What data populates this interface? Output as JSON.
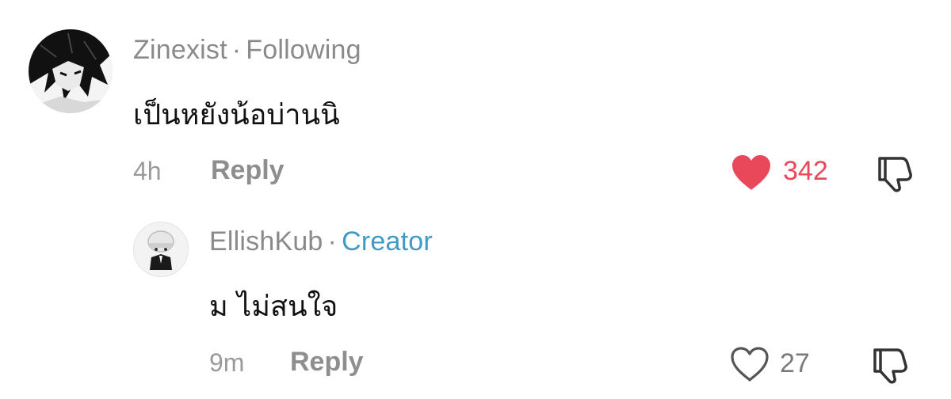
{
  "comments": [
    {
      "username": "Zinexist",
      "separator": "·",
      "badge": "Following",
      "text": "เป็นหยังน้อบ่านนิ",
      "time": "4h",
      "reply_label": "Reply",
      "likes": "342",
      "liked": true,
      "like_color": "#e8485a",
      "avatar_icon": "avatar-manga-character"
    },
    {
      "username": "EllishKub",
      "separator": "·",
      "badge": "Creator",
      "badge_color": "#3e9ac7",
      "text": "ม ไม่สนใจ",
      "time": "9m",
      "reply_label": "Reply",
      "likes": "27",
      "liked": false,
      "avatar_icon": "avatar-chibi-character"
    }
  ]
}
